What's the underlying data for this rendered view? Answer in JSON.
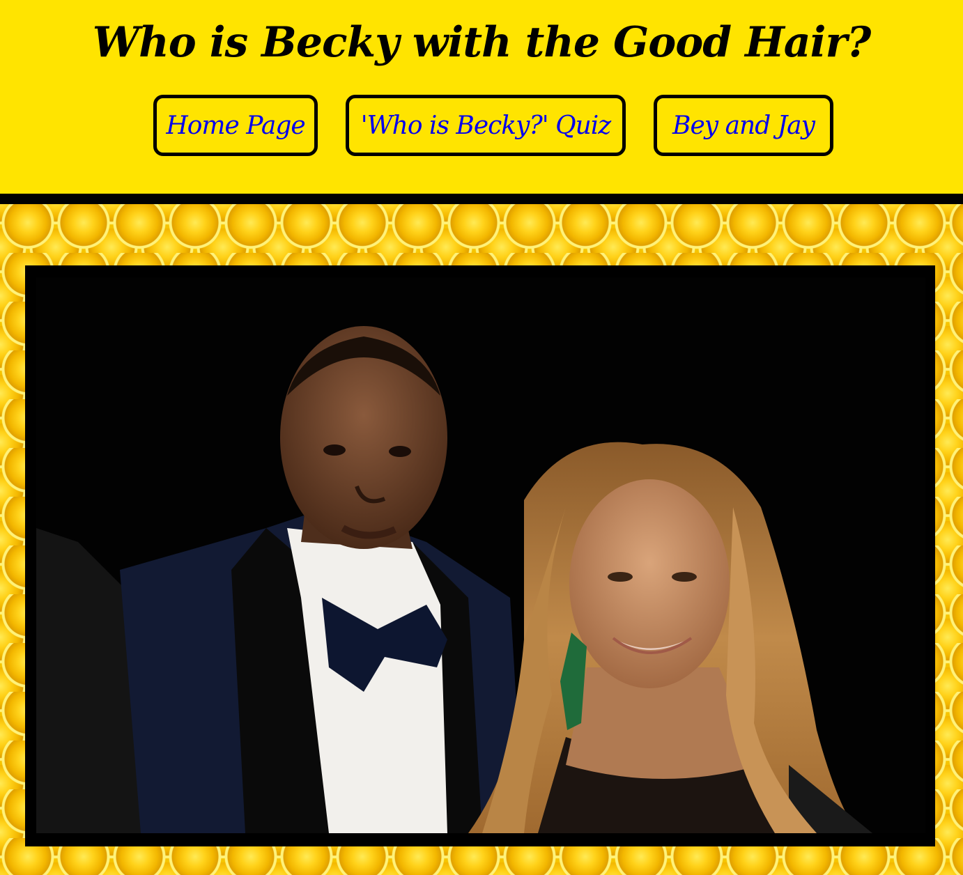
{
  "header": {
    "title": "Who is Becky with the Good Hair?",
    "background_color": "#ffe400"
  },
  "nav": {
    "items": [
      {
        "label": "Home Page"
      },
      {
        "label": "'Who is Becky?' Quiz"
      },
      {
        "label": "Bey and Jay"
      }
    ],
    "link_color": "#0000ee"
  },
  "main": {
    "background_pattern": "honeycomb",
    "photo": {
      "description_icon": "photo-of-couple",
      "alt": ""
    }
  }
}
